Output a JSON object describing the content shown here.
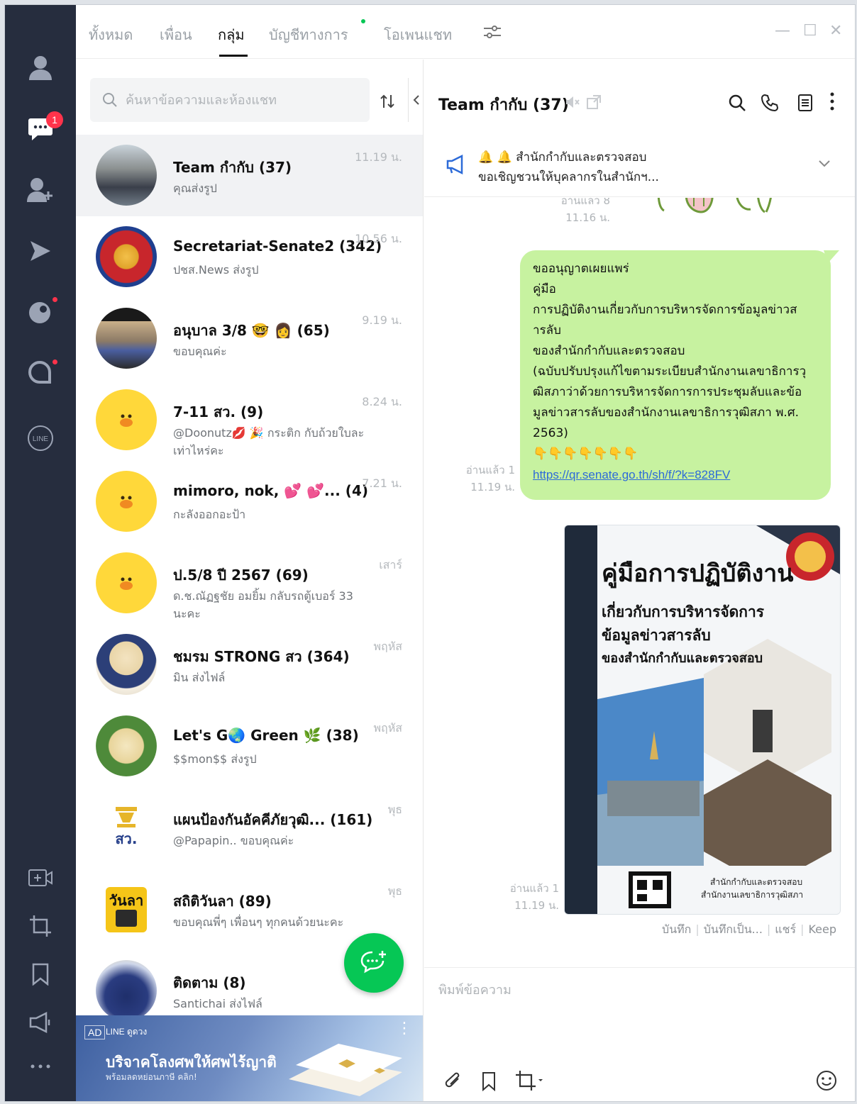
{
  "tabs": {
    "items": [
      {
        "label": "ทั้งหมด"
      },
      {
        "label": "เพื่อน"
      },
      {
        "label": "กลุ่ม"
      },
      {
        "label": "บัญชีทางการ"
      },
      {
        "label": "โอเพนแชท"
      }
    ],
    "active": "กลุ่ม"
  },
  "rail": {
    "chat_badge": "1"
  },
  "search": {
    "placeholder": "ค้นหาข้อความและห้องแชท"
  },
  "chats": [
    {
      "name": "Team กำกับ (37)",
      "preview": "คุณส่งรูป",
      "time": "11.19 น."
    },
    {
      "name": "Secretariat-Senate2 (342)",
      "preview": "ปชส.News ส่งรูป",
      "time": "10.56 น."
    },
    {
      "name": "อนุบาล 3/8 🤓 👩 (65)",
      "preview": "ขอบคุณค่ะ",
      "time": "9.19 น."
    },
    {
      "name": "7-11 สว. (9)",
      "preview": "@Doonutz💋 🎉 กระติก กับถ้วยใบละเท่าไหร่คะ",
      "time": "8.24 น."
    },
    {
      "name": "mimoro, nok, 💕 💕... (4)",
      "preview": "กะลังออกอะป้า",
      "time": "7.21 น."
    },
    {
      "name": "ป.5/8 ปี 2567 (69)",
      "preview": "ด.ช.ณัฏฐชัย อมยิ้ม กลับรถตู้เบอร์ 33 นะคะ",
      "time": "เสาร์"
    },
    {
      "name": "ชมรม STRONG สว (364)",
      "preview": "มิน ส่งไฟล์",
      "time": "พฤหัส"
    },
    {
      "name": "Let's G🌏 Green 🌿 (38)",
      "preview": "$$mon$$ ส่งรูป",
      "time": "พฤหัส"
    },
    {
      "name": "แผนป้องกันอัคคีภัยวุฒิ... (161)",
      "preview": "@Papapin.. ขอบคุณค่ะ",
      "time": "พุธ"
    },
    {
      "name": "สถิติวันลา (89)",
      "preview": "ขอบคุณพี่ๆ เพื่อนๆ ทุกคนด้วยนะคะ",
      "time": "พุธ"
    },
    {
      "name": "ติดตาม (8)",
      "preview": "Santichai ส่งไฟล์",
      "time": ""
    }
  ],
  "ad": {
    "tag": "AD",
    "brand": "LINE ดูดวง",
    "title": "บริจาคโลงศพให้ศพไร้ญาติ",
    "subtitle": "พร้อมลดหย่อนภาษี คลิก!"
  },
  "room": {
    "title": "Team กำกับ (37)",
    "announcement_line1": "🔔 🔔 สำนักกำกับและตรวจสอบ",
    "announcement_line2": "ขอเชิญชวนให้บุคลากรในสำนักฯ..."
  },
  "messages": {
    "prev_read": "อ่านแล้ว 8",
    "prev_time": "11.16 น.",
    "text_read": "อ่านแล้ว 1",
    "text_time": "11.19 น.",
    "text_body": "ขออนุญาตเผยแพร่\nคู่มือ\nการปฏิบัติงานเกี่ยวกับการบริหารจัดการข้อมูลข่าวส\nารลับ\nของสำนักกำกับและตรวจสอบ\n(ฉบับปรับปรุงแก้ไขตามระเบียบสำนักงานเลขาธิการวุ\nฒิสภาว่าด้วยการบริหารจัดการการประชุมลับและข้อ\nมูลข่าวสารลับของสำนักงานเลขาธิการวุฒิสภา พ.ศ.\n2563)\n👇👇👇👇👇👇👇",
    "text_link": "https://qr.senate.go.th/sh/f/?k=828FV",
    "image_read": "อ่านแล้ว 1",
    "image_time": "11.19 น.",
    "poster_title": "คู่มือการปฏิบัติงาน",
    "poster_line2": "เกี่ยวกับการบริหารจัดการ",
    "poster_line3": "ข้อมูลข่าวสารลับ",
    "poster_line4": "ของสำนักกำกับและตรวจสอบ",
    "poster_foot1": "สำนักกำกับและตรวจสอบ",
    "poster_foot2": "สำนักงานเลขาธิการวุฒิสภา",
    "actions": [
      "บันทึก",
      "บันทึกเป็น...",
      "แชร์",
      "Keep"
    ]
  },
  "composer": {
    "placeholder": "พิมพ์ข้อความ"
  },
  "colors": {
    "rail": "#262d3e",
    "line_green": "#06c755",
    "bubble": "#c7f2a0",
    "badge": "#ff334b",
    "link": "#2d6bd8"
  }
}
